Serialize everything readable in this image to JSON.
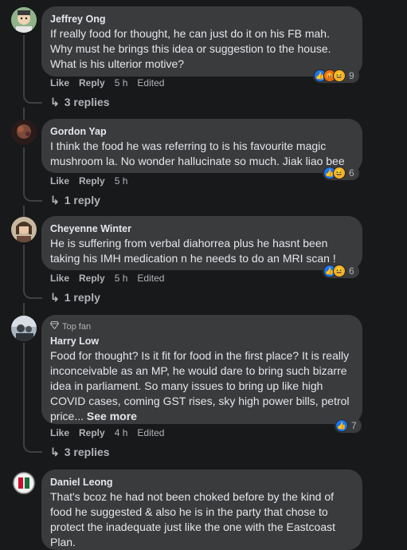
{
  "comments": [
    {
      "author": "Jeffrey Ong",
      "text": "If really food for thought, he can just do it on his FB mah. Why must he brings this idea or suggestion to the house. What is his ulterior motive?",
      "like": "Like",
      "reply": "Reply",
      "time": "5 h",
      "edited": "Edited",
      "reaction_count": "9",
      "replies": "3 replies"
    },
    {
      "author": "Gordon Yap",
      "text": "I think the food he was referring to is his favourite magic mushroom la. No wonder hallucinate so much. Jiak liao bee",
      "like": "Like",
      "reply": "Reply",
      "time": "5 h",
      "reaction_count": "6",
      "replies": "1 reply"
    },
    {
      "author": "Cheyenne Winter",
      "text": "He is suffering from verbal diahorrea plus he hasnt been taking his IMH medication n he needs to do an MRI scan !",
      "like": "Like",
      "reply": "Reply",
      "time": "5 h",
      "edited": "Edited",
      "reaction_count": "6",
      "replies": "1 reply"
    },
    {
      "badge": "Top fan",
      "author": "Harry Low",
      "text": "Food for thought? Is it fit for food in the first place? It is really inconceivable as an MP, he would dare to bring such bizarre idea in parliament. So many issues to bring up like high COVID cases, coming GST rises, sky high power bills, petrol price...",
      "see_more": "See more",
      "like": "Like",
      "reply": "Reply",
      "time": "4 h",
      "edited": "Edited",
      "reaction_count": "7",
      "replies": "3 replies"
    },
    {
      "author": "Daniel Leong",
      "text": "That's bcoz he had not been choked before by the kind of food he suggested & also he is in the party that chose to protect the inadequate just like the one with the Eastcoast Plan."
    }
  ],
  "colors": {
    "background": "#18191a",
    "bubble": "#3a3b3c",
    "text": "#e4e6eb",
    "muted": "#b0b3b8",
    "like_blue": "#1877f2"
  },
  "icons": {
    "like": "thumbs-up-icon",
    "angry": "angry-face-icon",
    "haha": "haha-face-icon",
    "reply_arrow": "reply-arrow-icon",
    "diamond": "diamond-icon"
  }
}
